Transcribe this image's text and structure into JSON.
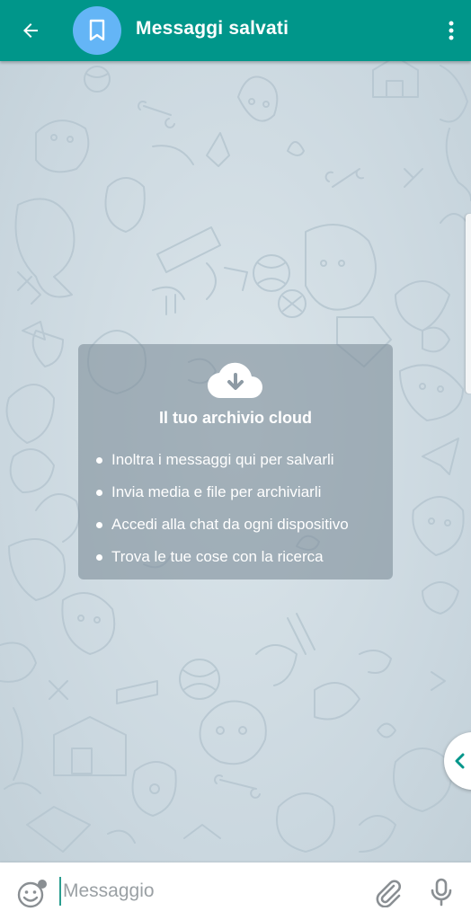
{
  "header": {
    "title": "Messaggi salvati",
    "back_icon": "arrow-left-icon",
    "avatar_icon": "bookmark-icon",
    "menu_icon": "more-vertical-icon",
    "background": "#00968a",
    "avatar_color": "#64b5f6"
  },
  "info_card": {
    "icon": "cloud-download-icon",
    "title": "Il tuo archivio cloud",
    "features": [
      "Inoltra i messaggi qui per salvarli",
      "Invia media e file per archiviarli",
      "Accedi alla chat da ogni dispositivo",
      "Trova le tue cose con la ricerca"
    ]
  },
  "side_toggle": {
    "icon": "chevron-left-icon"
  },
  "input_bar": {
    "placeholder": "Messaggio",
    "value": "",
    "emoji_icon": "emoji-icon",
    "attach_icon": "paperclip-icon",
    "mic_icon": "microphone-icon"
  }
}
